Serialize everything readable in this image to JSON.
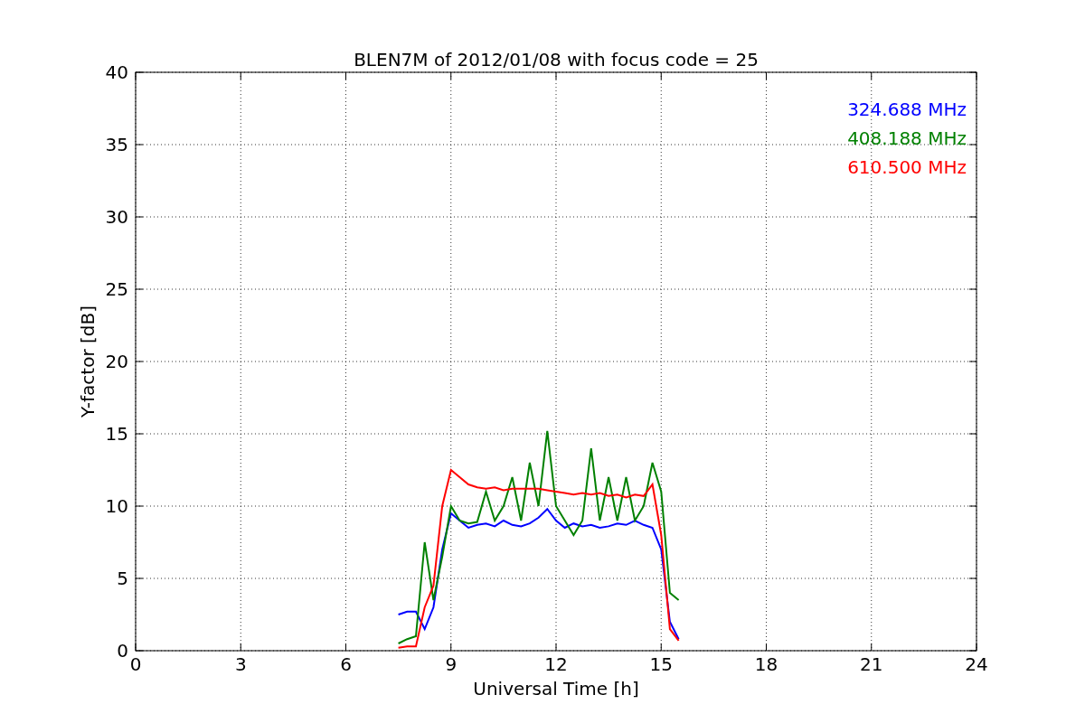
{
  "chart_data": {
    "type": "line",
    "title": "BLEN7M of 2012/01/08 with focus code = 25",
    "xlabel": "Universal Time [h]",
    "ylabel": "Y-factor [dB]",
    "x": [
      7.5,
      7.75,
      8,
      8.25,
      8.5,
      8.75,
      9,
      9.25,
      9.5,
      9.75,
      10,
      10.25,
      10.5,
      10.75,
      11,
      11.25,
      11.5,
      11.75,
      12,
      12.25,
      12.5,
      12.75,
      13,
      13.25,
      13.5,
      13.75,
      14,
      14.25,
      14.5,
      14.75,
      15,
      15.25,
      15.5
    ],
    "series": [
      {
        "name": "324.688 MHz",
        "color": "#0000ff",
        "values": [
          2.5,
          2.7,
          2.7,
          1.5,
          3,
          7,
          9.5,
          9,
          8.5,
          8.7,
          8.8,
          8.6,
          9,
          8.7,
          8.6,
          8.8,
          9.2,
          9.8,
          9,
          8.5,
          8.8,
          8.6,
          8.7,
          8.5,
          8.6,
          8.8,
          8.7,
          9,
          8.7,
          8.5,
          7,
          2,
          0.8
        ]
      },
      {
        "name": "408.188 MHz",
        "color": "#008000",
        "values": [
          0.5,
          0.8,
          1,
          7.5,
          3.5,
          6.5,
          10,
          9,
          8.8,
          8.9,
          11,
          9,
          10,
          12,
          9,
          13,
          10,
          15.2,
          10,
          9,
          8,
          9,
          14,
          9,
          12,
          9,
          12,
          9,
          10,
          13,
          11,
          4,
          3.5
        ]
      },
      {
        "name": "610.500 MHz",
        "color": "#ff0000",
        "values": [
          0.2,
          0.3,
          0.3,
          3,
          4.5,
          10,
          12.5,
          12,
          11.5,
          11.3,
          11.2,
          11.3,
          11.1,
          11.2,
          11.2,
          11.2,
          11.2,
          11.1,
          11,
          10.9,
          10.8,
          10.9,
          10.8,
          10.9,
          10.7,
          10.8,
          10.6,
          10.8,
          10.7,
          11.5,
          8,
          1.5,
          0.7
        ]
      }
    ],
    "xlim": [
      0,
      24
    ],
    "ylim": [
      0,
      40
    ],
    "xticks": [
      0,
      3,
      6,
      9,
      12,
      15,
      18,
      21,
      24
    ],
    "yticks": [
      0,
      5,
      10,
      15,
      20,
      25,
      30,
      35,
      40
    ],
    "grid": true
  }
}
